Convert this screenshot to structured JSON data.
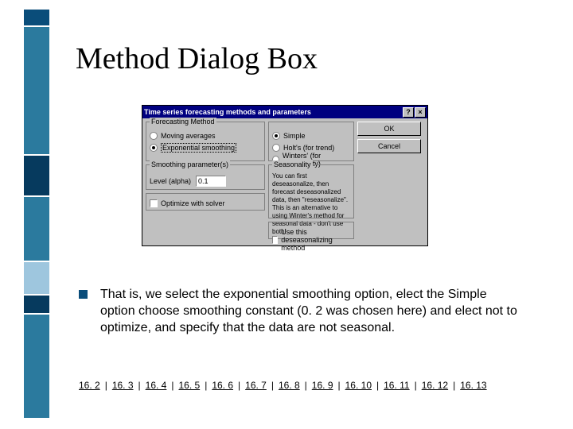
{
  "slide": {
    "title": "Method Dialog Box"
  },
  "dialog": {
    "title": "Time series forecasting methods and parameters",
    "help_btn": "?",
    "close_btn": "×",
    "buttons": {
      "ok": "OK",
      "cancel": "Cancel"
    },
    "forecasting_method": {
      "legend": "Forecasting Method",
      "moving_averages": "Moving averages",
      "exponential_smoothing": "Exponential smoothing"
    },
    "smoothing_type": {
      "simple": "Simple",
      "holts": "Holt's (for trend)",
      "winters": "Winters' (for seasonality)"
    },
    "params": {
      "legend": "Smoothing parameter(s)",
      "level_label": "Level (alpha)",
      "level_value": "0.1"
    },
    "optimize": {
      "label": "Optimize with solver"
    },
    "seasonality": {
      "legend": "Seasonality",
      "desc": "You can first deseasonalize, then forecast deseasonalized data, then \"reseasonalize\". This is an alternative to using Winter's method for seasonal data - don't use both!",
      "checkbox_label": "Use this deseasonalizing method"
    }
  },
  "bullet": {
    "text": "That is, we select the exponential smoothing option, elect the Simple option choose smoothing constant (0. 2 was chosen here) and elect not to optimize, and specify that the data are not seasonal."
  },
  "footer": {
    "links": [
      "16. 2",
      "16. 3",
      "16. 4",
      "16. 5",
      "16. 6",
      "16. 7",
      "16. 8",
      "16. 9",
      "16. 10",
      "16. 11",
      "16. 12",
      "16. 13"
    ]
  }
}
